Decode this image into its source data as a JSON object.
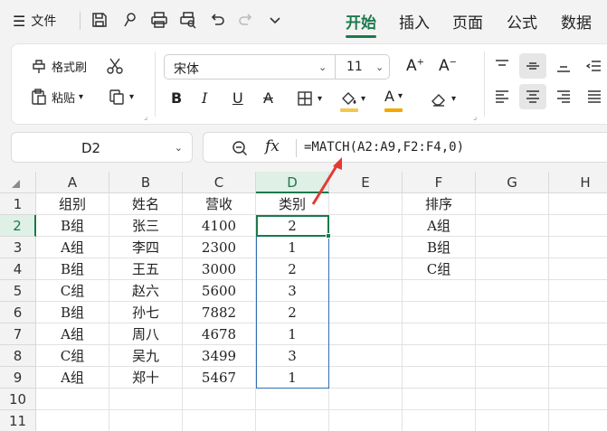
{
  "menu": {
    "file_label": "文件",
    "tabs": [
      {
        "label": "开始",
        "active": true
      },
      {
        "label": "插入",
        "active": false
      },
      {
        "label": "页面",
        "active": false
      },
      {
        "label": "公式",
        "active": false
      },
      {
        "label": "数据",
        "active": false
      }
    ]
  },
  "ribbon": {
    "format_painter": "格式刷",
    "paste": "粘贴",
    "font_name": "宋体",
    "font_size": "11",
    "fill_color": "#f2c94c",
    "font_color": "#f2a900"
  },
  "formula_bar": {
    "name_box": "D2",
    "fx_label": "fx",
    "formula": "=MATCH(A2:A9,F2:F4,0)"
  },
  "colors": {
    "accent": "#1a7a4c",
    "selection_border": "#2f6fb3",
    "arrow": "#e53935"
  },
  "sheet": {
    "columns": [
      "A",
      "B",
      "C",
      "D",
      "E",
      "F",
      "G",
      "H"
    ],
    "rows": [
      "1",
      "2",
      "3",
      "4",
      "5",
      "6",
      "7",
      "8",
      "9",
      "10",
      "11"
    ],
    "cells": {
      "A1": "组别",
      "B1": "姓名",
      "C1": "营收",
      "D1": "类别",
      "F1": "排序",
      "A2": "B组",
      "B2": "张三",
      "C2": "4100",
      "D2": "2",
      "F2": "A组",
      "A3": "A组",
      "B3": "李四",
      "C3": "2300",
      "D3": "1",
      "F3": "B组",
      "A4": "B组",
      "B4": "王五",
      "C4": "3000",
      "D4": "2",
      "F4": "C组",
      "A5": "C组",
      "B5": "赵六",
      "C5": "5600",
      "D5": "3",
      "A6": "B组",
      "B6": "孙七",
      "C6": "7882",
      "D6": "2",
      "A7": "A组",
      "B7": "周八",
      "C7": "4678",
      "D7": "1",
      "A8": "C组",
      "B8": "吴九",
      "C8": "3499",
      "D8": "3",
      "A9": "A组",
      "B9": "郑十",
      "C9": "5467",
      "D9": "1"
    }
  }
}
